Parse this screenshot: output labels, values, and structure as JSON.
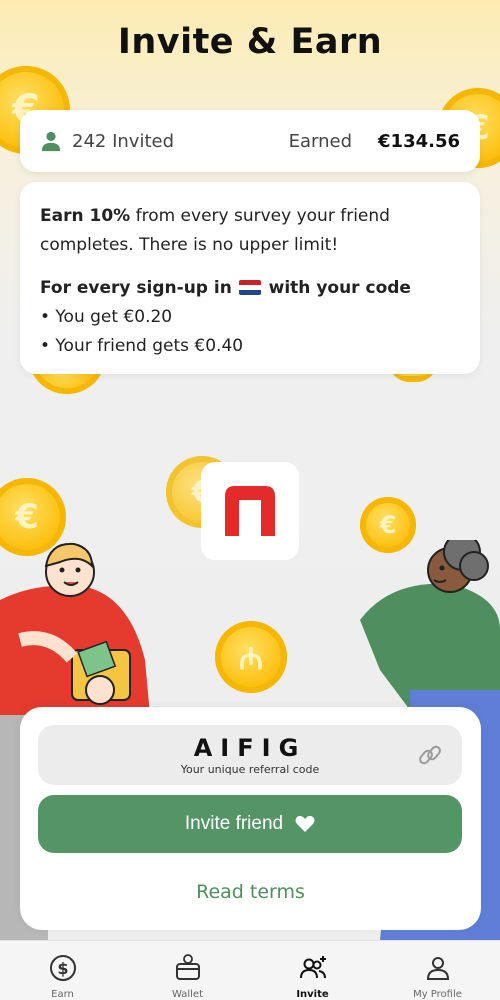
{
  "header": {
    "title": "Invite & Earn"
  },
  "stats": {
    "invited": "242 Invited",
    "earned_label": "Earned",
    "earned_value": "€134.56"
  },
  "info": {
    "earn_bold": "Earn 10%",
    "earn_rest": " from every survey your friend completes. There is no upper limit!",
    "signup_prefix": "For every sign-up in",
    "signup_suffix": "with your code",
    "you_get": "• You get €0.20",
    "friend_gets": "• Your friend gets €0.40"
  },
  "referral": {
    "code": "AIFIG",
    "caption": "Your unique referral code"
  },
  "actions": {
    "invite_label": "Invite friend",
    "terms_label": "Read terms"
  },
  "nav": {
    "items": [
      {
        "label": "Earn",
        "icon": "dollar-circle-icon"
      },
      {
        "label": "Wallet",
        "icon": "wallet-icon"
      },
      {
        "label": "Invite",
        "icon": "invite-users-icon",
        "active": true
      },
      {
        "label": "My Profile",
        "icon": "user-icon"
      }
    ]
  },
  "colors": {
    "accent_green": "#559466",
    "coin_yellow": "#fcc419",
    "brand_red": "#e52a2a"
  },
  "flag": "Netherlands"
}
